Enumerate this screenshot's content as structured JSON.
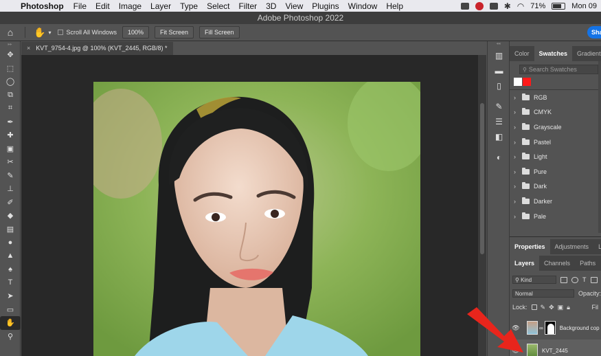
{
  "menubar": {
    "app_name": "Photoshop",
    "items": [
      "File",
      "Edit",
      "Image",
      "Layer",
      "Type",
      "Select",
      "Filter",
      "3D",
      "View",
      "Plugins",
      "Window",
      "Help"
    ],
    "battery": "71%",
    "clock": "Mon 09"
  },
  "window": {
    "title": "Adobe Photoshop 2022"
  },
  "options_bar": {
    "scroll_all_label": "Scroll All Windows",
    "zoom_button": "100%",
    "fit_screen_button": "Fit Screen",
    "fill_screen_button": "Fill Screen",
    "share_label": "Sha"
  },
  "document": {
    "tab_title": "KVT_9754-4.jpg @ 100% (KVT_2445, RGB/8) *"
  },
  "swatches_panel": {
    "tabs": [
      "Color",
      "Swatches",
      "Gradients"
    ],
    "active_tab": "Swatches",
    "search_placeholder": "Search Swatches",
    "recent_colors": [
      "#ffffff",
      "#ff1a1a"
    ],
    "groups": [
      "RGB",
      "CMYK",
      "Grayscale",
      "Pastel",
      "Light",
      "Pure",
      "Dark",
      "Darker",
      "Pale"
    ]
  },
  "properties_panel": {
    "tabs": [
      "Properties",
      "Adjustments",
      "Lib"
    ]
  },
  "layers_panel": {
    "tabs": [
      "Layers",
      "Channels",
      "Paths"
    ],
    "filter_kind": "Kind",
    "blend_mode": "Normal",
    "opacity_label": "Opacity:",
    "lock_label": "Lock:",
    "fill_label": "Fil",
    "layers": [
      {
        "name": "Background cop",
        "visible": true,
        "has_mask": true
      },
      {
        "name": "KVT_2445",
        "visible": true,
        "has_mask": false
      }
    ]
  },
  "colors": {
    "accent_blue": "#1473e6",
    "annotation_arrow": "#e8251c"
  }
}
